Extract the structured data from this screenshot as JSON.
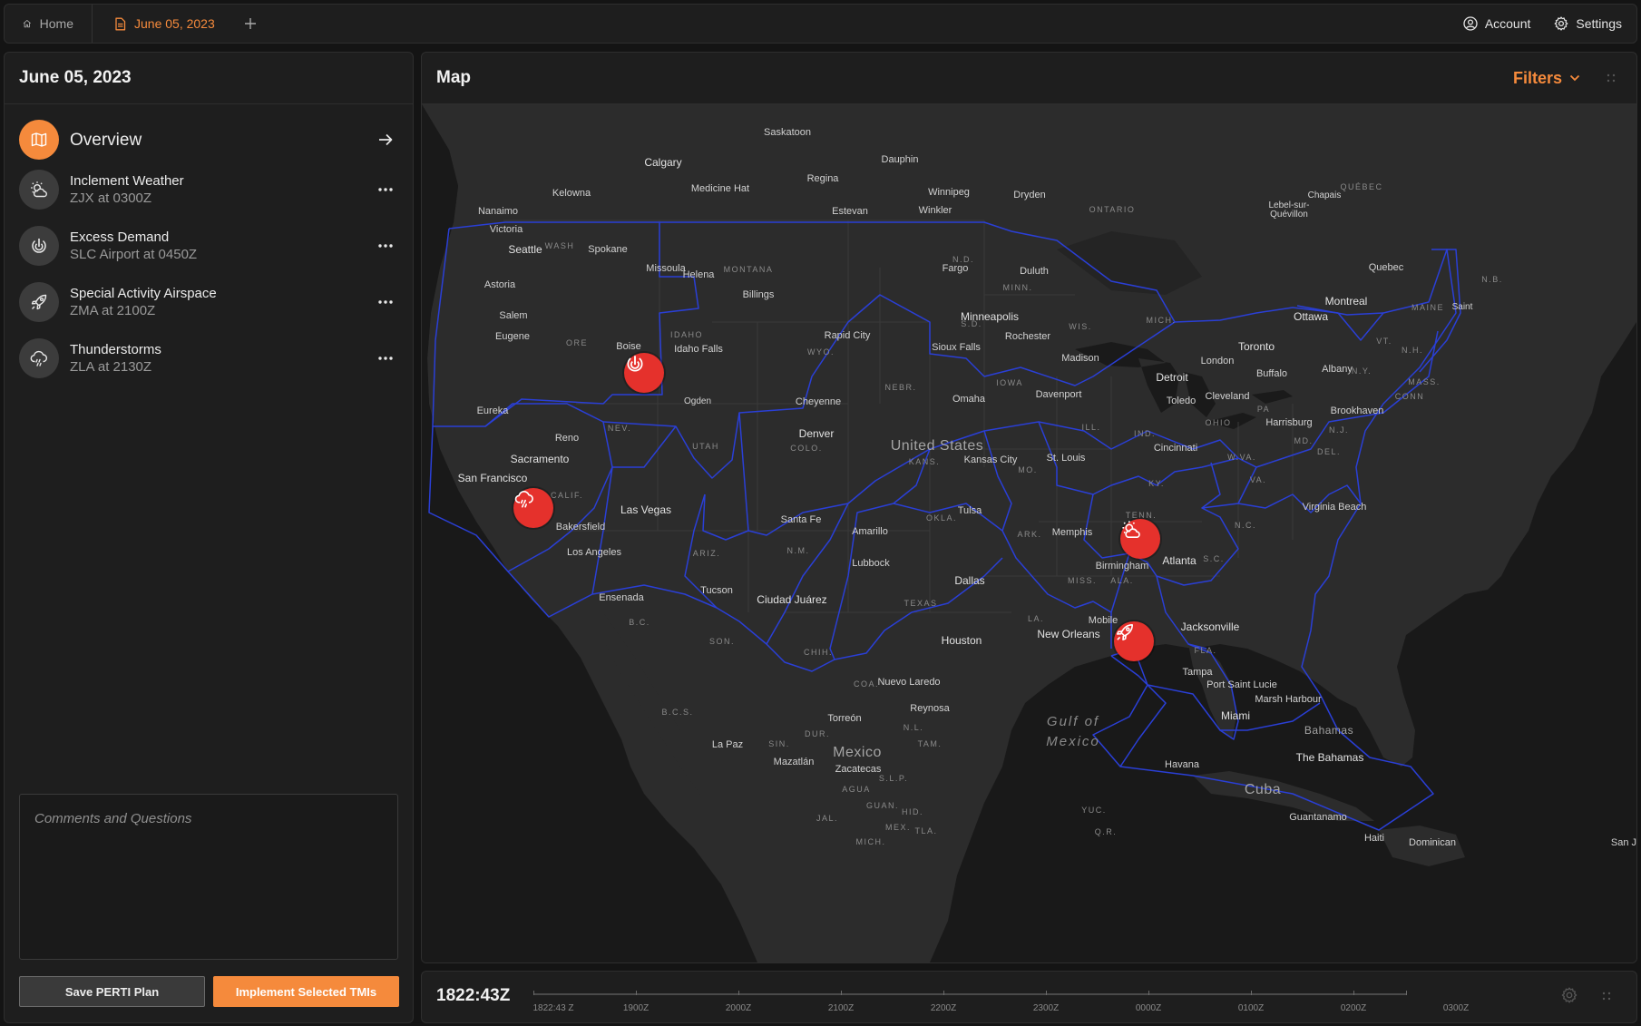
{
  "topbar": {
    "home_label": "Home",
    "active_tab_label": "June 05, 2023",
    "account_label": "Account",
    "settings_label": "Settings"
  },
  "sidebar": {
    "title": "June 05, 2023",
    "items": [
      {
        "title": "Overview",
        "subtitle": "",
        "icon": "map-icon"
      },
      {
        "title": "Inclement Weather",
        "subtitle": "ZJX at 0300Z",
        "icon": "sun-cloud-icon"
      },
      {
        "title": "Excess Demand",
        "subtitle": "SLC Airport at 0450Z",
        "icon": "power-target-icon"
      },
      {
        "title": "Special Activity Airspace",
        "subtitle": "ZMA at 2100Z",
        "icon": "rocket-icon"
      },
      {
        "title": "Thunderstorms",
        "subtitle": "ZLA at 2130Z",
        "icon": "storm-cloud-icon"
      }
    ],
    "comments_placeholder": "Comments and Questions",
    "save_label": "Save PERTI Plan",
    "implement_label": "Implement Selected TMIs"
  },
  "map": {
    "title": "Map",
    "filters_label": "Filters",
    "country_labels": {
      "us": "United States",
      "mexico": "Mexico",
      "cuba": "Cuba",
      "bahamas": "Bahamas",
      "bahamas_the": "The Bahamas"
    },
    "water_labels": {
      "gulf": "Gulf of",
      "mexico": "Mexico"
    },
    "cities": {
      "saskatoon": "Saskatoon",
      "calgary": "Calgary",
      "dauphin": "Dauphin",
      "regina": "Regina",
      "medicine_hat": "Medicine Hat",
      "kelowna": "Kelowna",
      "winnipeg": "Winnipeg",
      "dryden": "Dryden",
      "estevan": "Estevan",
      "winkler": "Winkler",
      "nanaimo": "Nanaimo",
      "victoria": "Victoria",
      "seattle": "Seattle",
      "spokane": "Spokane",
      "missoula": "Missoula",
      "helena": "Helena",
      "astoria": "Astoria",
      "salem": "Salem",
      "eugene": "Eugene",
      "billings": "Billings",
      "fargo": "Fargo",
      "duluth": "Duluth",
      "minneapolis": "Minneapolis",
      "rapid_city": "Rapid City",
      "boise": "Boise",
      "idaho_falls": "Idaho Falls",
      "sioux_falls": "Sioux Falls",
      "rochester": "Rochester",
      "madison": "Madison",
      "detroit": "Detroit",
      "toronto": "Toronto",
      "london": "London",
      "buffalo": "Buffalo",
      "ottawa": "Ottawa",
      "montreal": "Montreal",
      "quebec": "Quebec",
      "lebel": "Lebel-sur-",
      "quevillon": "Quévillon",
      "chapais": "Chapais",
      "saint": "Saint",
      "albany": "Albany",
      "eureka": "Eureka",
      "ogden": "Ogden",
      "cheyenne": "Cheyenne",
      "omaha": "Omaha",
      "davenport": "Davenport",
      "toledo": "Toledo",
      "cleveland": "Cleveland",
      "brookhaven": "Brookhaven",
      "harrisburg": "Harrisburg",
      "reno": "Reno",
      "sacramento": "Sacramento",
      "denver": "Denver",
      "kansas_city": "Kansas City",
      "st_louis": "St. Louis",
      "cincinnati": "Cincinnati",
      "san_francisco": "San Francisco",
      "las_vegas": "Las Vegas",
      "virginia_beach": "Virginia Beach",
      "santa_fe": "Santa Fe",
      "tulsa": "Tulsa",
      "bakersfield": "Bakersfield",
      "amarillo": "Amarillo",
      "memphis": "Memphis",
      "los_angeles": "Los Angeles",
      "lubbock": "Lubbock",
      "birmingham": "Birmingham",
      "atlanta": "Atlanta",
      "tucson": "Tucson",
      "ensenada": "Ensenada",
      "ciudad_juarez": "Ciudad Juárez",
      "dallas": "Dallas",
      "mobile": "Mobile",
      "jacksonville": "Jacksonville",
      "houston": "Houston",
      "new_orleans": "New Orleans",
      "tampa": "Tampa",
      "port_st_lucie": "Port Saint Lucie",
      "marsh_harbour": "Marsh Harbour",
      "nuevo_laredo": "Nuevo Laredo",
      "miami": "Miami",
      "reynosa": "Reynosa",
      "torreon": "Torreón",
      "la_paz": "La Paz",
      "mazatlan": "Mazatlán",
      "zacatecas": "Zacatecas",
      "havana": "Havana",
      "guantanamo": "Guantanamo",
      "haiti": "Haiti",
      "dominican": "Dominican",
      "san_j": "San J"
    },
    "regions": {
      "wash": "WASH",
      "montana": "MONTANA",
      "nd": "N.D.",
      "minn": "MINN.",
      "ontario": "ONTARIO",
      "quebec": "QUÉBEC",
      "ore": "ORE",
      "idaho": "IDAHO",
      "wyo": "WYO.",
      "sd": "S.D.",
      "mich": "MICH.",
      "wis": "WIS.",
      "maine": "MAINE",
      "vt": "VT.",
      "nh": "N.H.",
      "ny": "N.Y.",
      "mass": "MASS.",
      "conn": "CONN",
      "nb": "N.B.",
      "pa": "PA",
      "nj": "N.J.",
      "ohio": "OHIO",
      "ind": "IND.",
      "ill": "ILL.",
      "iowa": "IOWA",
      "nebr": "NEBR.",
      "nev": "NEV.",
      "utah": "UTAH",
      "colo": "COLO.",
      "kans": "KANS.",
      "mo": "MO.",
      "ky": "KY.",
      "wva": "W.VA.",
      "va": "VA.",
      "md": "MD.",
      "del": "DEL.",
      "calif": "CALIF.",
      "tenn": "TENN.",
      "nc": "N.C.",
      "okla": "OKLA.",
      "ark": "ARK.",
      "ariz": "ARIZ.",
      "nm": "N.M.",
      "sc": "S.C.",
      "miss": "MISS.",
      "ala": "ALA.",
      "texas": "TEXAS",
      "la": "LA.",
      "bc": "B.C.",
      "son": "SON.",
      "chih": "CHIH.",
      "fla": "FLA.",
      "coa": "COA.",
      "nl": "N.L.",
      "bcs": "B.C.S.",
      "dur": "DUR.",
      "tam": "TAM.",
      "sin": "SIN.",
      "slp": "S.L.P.",
      "jal": "JAL.",
      "gto": "GUAN.",
      "hid": "HID.",
      "mex": "MEX.",
      "tla": "TLA.",
      "mich2": "MICH.",
      "ags": "AGUA",
      "yuc": "YUC.",
      "qr": "Q.R."
    },
    "markers": [
      {
        "name": "excess-demand-marker",
        "icon": "power-target-icon"
      },
      {
        "name": "thunderstorms-marker",
        "icon": "storm-cloud-icon"
      },
      {
        "name": "inclement-weather-marker",
        "icon": "sun-cloud-icon"
      },
      {
        "name": "special-activity-marker",
        "icon": "rocket-icon"
      }
    ]
  },
  "timeline": {
    "current_time": "1822:43Z",
    "ticks": [
      "1822:43 Z",
      "1900Z",
      "2000Z",
      "2100Z",
      "2200Z",
      "2300Z",
      "0000Z",
      "0100Z",
      "0200Z",
      "0300Z"
    ]
  },
  "colors": {
    "accent": "#f58a3c",
    "marker": "#e5312c",
    "artcc_boundary": "#2a3fd6",
    "background": "#141414",
    "panel": "#1e1e1e"
  }
}
